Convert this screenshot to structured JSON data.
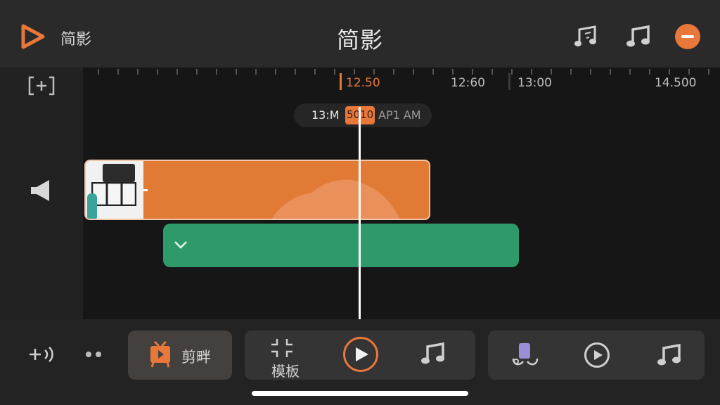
{
  "header": {
    "app_name": "简影",
    "title": "简影",
    "icons": [
      "play-logo-icon",
      "music-edit-icon",
      "music-note-icon",
      "stop-icon"
    ],
    "accent_color": "#e8773a"
  },
  "ruler": {
    "labels": [
      "12.50",
      "12:60",
      "13:00",
      "14.500"
    ],
    "current": "12.50"
  },
  "time_pill": {
    "left_text": "13:M",
    "badge_text": "5010",
    "right_text": "AP1 AM"
  },
  "tracks": {
    "video_color": "#e07a35",
    "audio_color": "#2e9a6a"
  },
  "bottom": {
    "edit_label": "剪畔",
    "template_label": "模板",
    "icons": [
      "add-audio-icon",
      "more-dots-icon",
      "clip-tv-icon",
      "template-compress-icon",
      "play-icon",
      "music-note-icon",
      "voice-record-icon",
      "play-outline-icon",
      "music-note-icon"
    ]
  }
}
